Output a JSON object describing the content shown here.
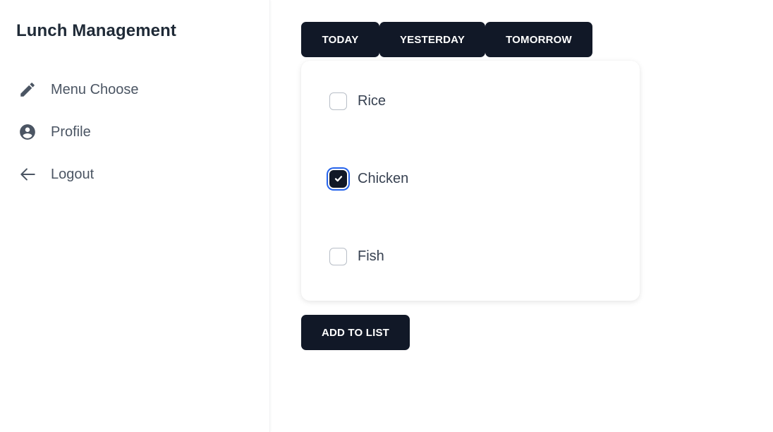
{
  "app": {
    "title": "Lunch Management"
  },
  "sidebar": {
    "items": [
      {
        "label": "Menu Choose",
        "icon": "pencil-icon"
      },
      {
        "label": "Profile",
        "icon": "user-circle-icon"
      },
      {
        "label": "Logout",
        "icon": "arrow-left-icon"
      }
    ]
  },
  "tabs": [
    {
      "label": "TODAY"
    },
    {
      "label": "YESTERDAY"
    },
    {
      "label": "TOMORROW"
    }
  ],
  "menu_options": [
    {
      "label": "Rice",
      "checked": false
    },
    {
      "label": "Chicken",
      "checked": true
    },
    {
      "label": "Fish",
      "checked": false
    }
  ],
  "actions": {
    "add_label": "ADD TO LIST"
  },
  "colors": {
    "button_bg": "#111827",
    "focus_ring": "#2563eb",
    "text_muted": "#4b5563"
  }
}
